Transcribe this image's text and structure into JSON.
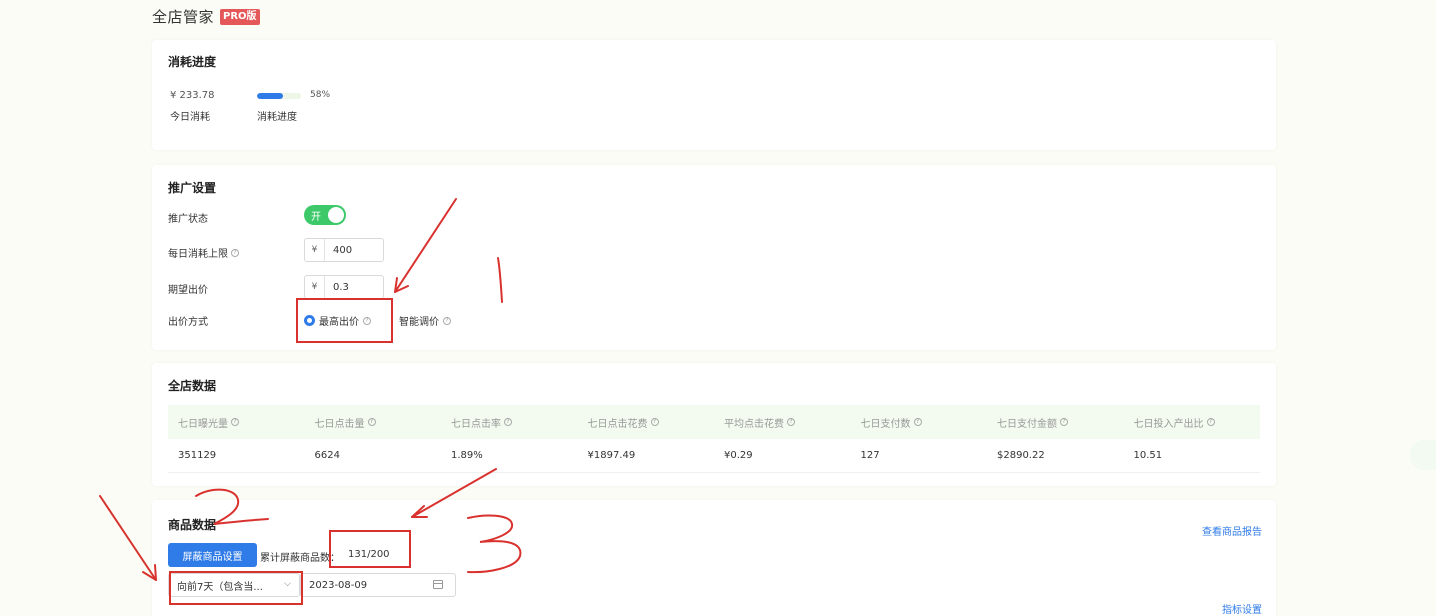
{
  "header": {
    "title": "全店管家",
    "badge": "PRO版"
  },
  "consume": {
    "title": "消耗进度",
    "amount": "¥ 233.78",
    "amount_label": "今日消耗",
    "progress": 0.58,
    "progress_text": "58%",
    "progress_label": "消耗进度"
  },
  "promo": {
    "title": "推广设置",
    "status_label": "推广状态",
    "toggle_text": "开",
    "daily_limit_label": "每日消耗上限",
    "currency": "¥",
    "daily_limit_value": "400",
    "bid_label": "期望出价",
    "bid_value": "0.3",
    "bid_method_label": "出价方式",
    "options": [
      "最高出价",
      "智能调价"
    ]
  },
  "store": {
    "title": "全店数据",
    "headers": [
      "七日曝光量",
      "七日点击量",
      "七日点击率",
      "七日点击花费",
      "平均点击花费",
      "七日支付数",
      "七日支付金额",
      "七日投入产出比"
    ],
    "values": [
      "351129",
      "6624",
      "1.89%",
      "¥1897.49",
      "¥0.29",
      "127",
      "$2890.22",
      "10.51"
    ]
  },
  "product": {
    "title": "商品数据",
    "report_link": "查看商品报告",
    "block_button": "屏蔽商品设置",
    "block_count_label": "累计屏蔽商品数：",
    "block_count_value": "131/200",
    "range_select": "向前7天（包含当...",
    "date": "2023-08-09",
    "metric_link": "指标设置"
  },
  "colors": {
    "accent": "#2f7be8",
    "toggle_on": "#3dc96a",
    "badge": "#e5585a",
    "annotation": "#d9322e"
  }
}
